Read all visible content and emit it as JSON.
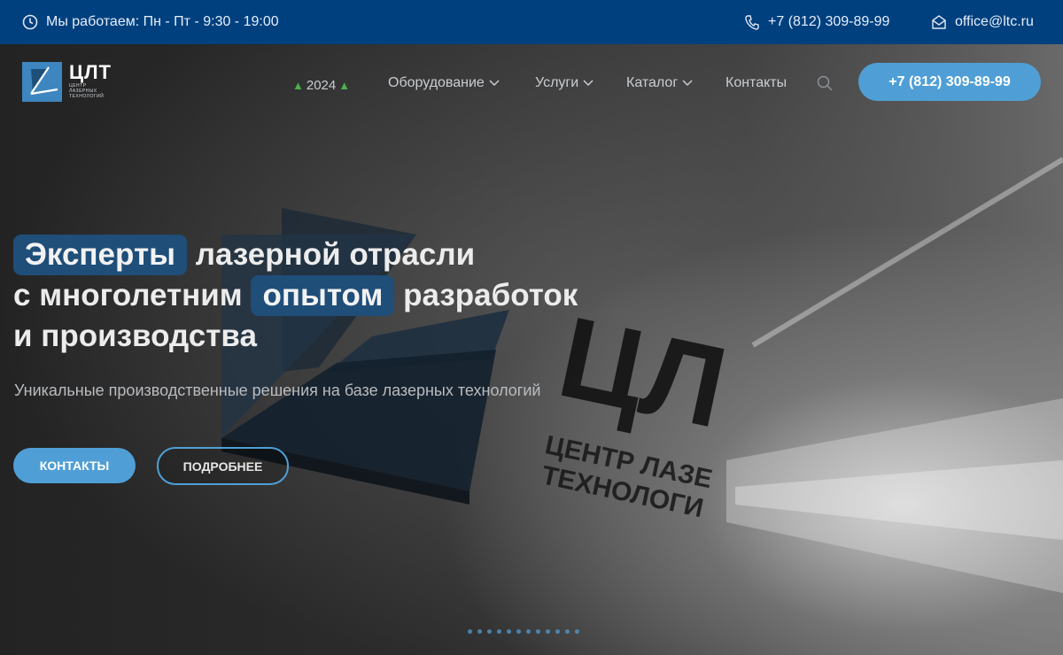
{
  "topbar": {
    "hours": "Мы работаем: Пн - Пт - 9:30 - 19:00",
    "phone": "+7 (812) 309-89-99",
    "email": "office@ltc.ru"
  },
  "logo": {
    "name": "ЦЛТ",
    "subtitle": "ЦЕНТР ЛАЗЕРНЫХ ТЕХНОЛОГИЙ"
  },
  "nav": {
    "year": "2024",
    "items": [
      "Оборудование",
      "Услуги",
      "Каталог",
      "Контакты"
    ]
  },
  "header": {
    "cta_phone": "+7 (812) 309-89-99"
  },
  "hero": {
    "highlight1": "Эксперты",
    "line1_rest": "лазерной отрасли",
    "line2_start": "с многолетним",
    "highlight2": "опытом",
    "line2_rest": "разработок",
    "line3": "и производства",
    "subtitle": "Уникальные производственные решения на базе лазерных технологий",
    "btn_contacts": "КОНТАКТЫ",
    "btn_more": "ПОДРОБНЕЕ"
  },
  "colors": {
    "topbar_bg": "#00407f",
    "accent": "#4f9fd6",
    "highlight_bg": "#1f4e79"
  },
  "icons": [
    "clock-icon",
    "phone-icon",
    "mail-icon",
    "tree-icon",
    "chevron-down-icon",
    "search-icon"
  ]
}
